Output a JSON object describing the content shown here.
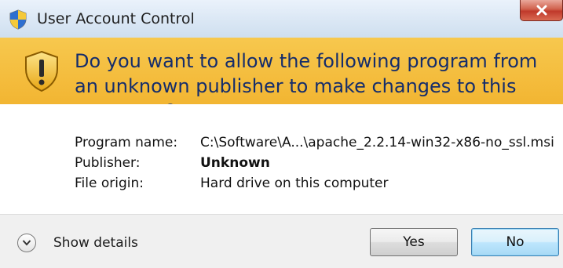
{
  "window": {
    "title": "User Account Control",
    "close_symbol": "✕"
  },
  "banner": {
    "question": "Do you want to allow the following program from an unknown publisher to make changes to this computer?",
    "icon": "warning-shield-icon",
    "color": "#f5bf40"
  },
  "details": {
    "rows": [
      {
        "label": "Program name:",
        "value": "C:\\Software\\A...\\apache_2.2.14-win32-x86-no_ssl.msi"
      },
      {
        "label": "Publisher:",
        "value": "Unknown"
      },
      {
        "label": "File origin:",
        "value": "Hard drive on this computer"
      }
    ]
  },
  "footer": {
    "show_details_label": "Show details",
    "yes_label": "Yes",
    "no_label": "No"
  }
}
